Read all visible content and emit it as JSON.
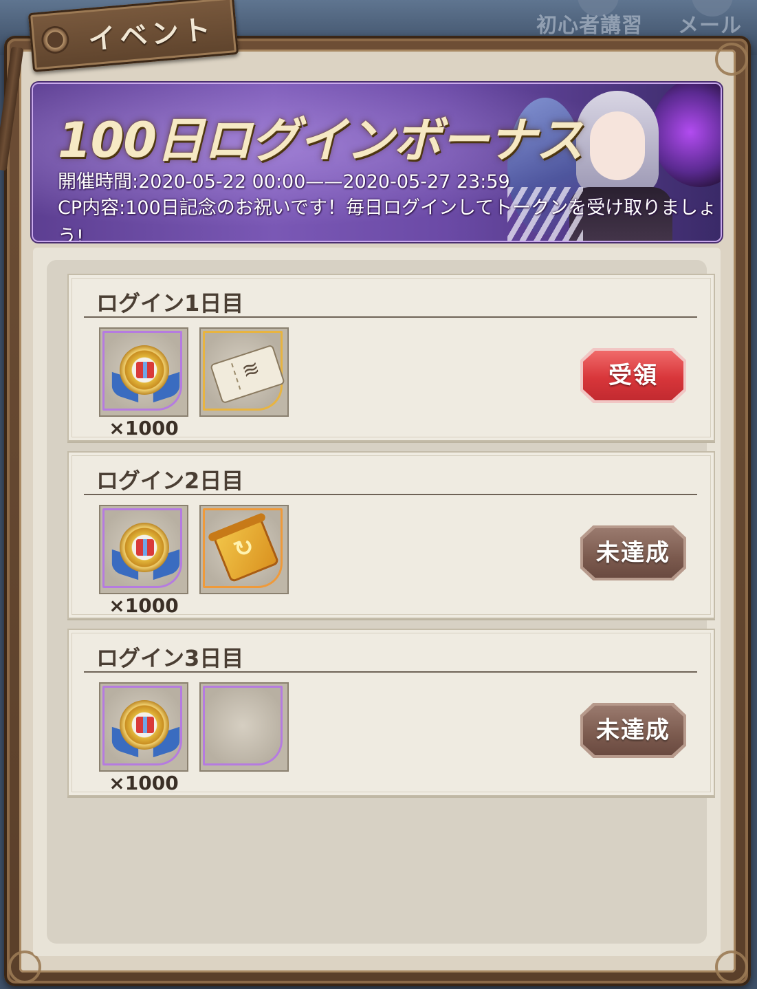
{
  "top_nav": {
    "beginner_label": "初心者講習",
    "mail_label": "メール"
  },
  "tab": {
    "label": "イベント"
  },
  "banner": {
    "title": "100日ログインボーナス",
    "period": "開催時間:2020-05-22 00:00——2020-05-27 23:59",
    "content_line1": "CP内容:100日記念のお祝いです！毎日ログインしてトークンを受け取りましょ",
    "content_line2": "う!"
  },
  "days": [
    {
      "title": "ログイン1日目",
      "rewards": [
        {
          "icon": "gift-medal-icon",
          "rarity": "purple",
          "count": "×1000"
        },
        {
          "icon": "ticket-icon",
          "rarity": "gold",
          "count": ""
        }
      ],
      "button": {
        "label": "受領",
        "state": "claimable"
      }
    },
    {
      "title": "ログイン2日目",
      "rewards": [
        {
          "icon": "gift-medal-icon",
          "rarity": "purple",
          "count": "×1000"
        },
        {
          "icon": "scroll-icon",
          "rarity": "orange",
          "count": ""
        }
      ],
      "button": {
        "label": "未達成",
        "state": "locked"
      }
    },
    {
      "title": "ログイン3日目",
      "rewards": [
        {
          "icon": "gift-medal-icon",
          "rarity": "purple",
          "count": "×1000"
        },
        {
          "icon": "empty-slot-icon",
          "rarity": "purple",
          "count": ""
        }
      ],
      "button": {
        "label": "未達成",
        "state": "locked"
      }
    }
  ],
  "colors": {
    "claim_button": "#d8363a",
    "locked_button": "#7b5a4e",
    "banner_purple": "#6b4aa6",
    "frame_brown": "#5a3f2a"
  }
}
